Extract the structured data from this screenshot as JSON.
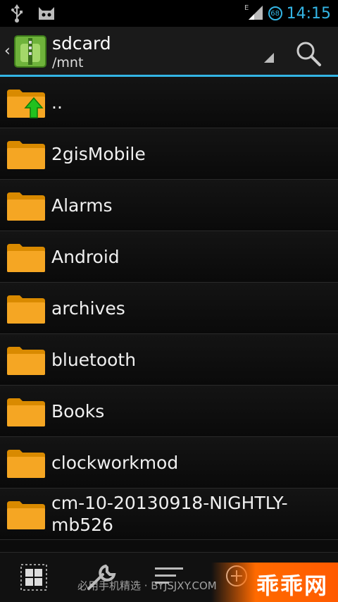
{
  "status_bar": {
    "clock": "14:15",
    "battery_level": "68",
    "network": "E",
    "colors": {
      "accent": "#33b5e5"
    },
    "icons": [
      "usb-icon",
      "cyanogen-icon",
      "signal-icon",
      "battery-icon"
    ]
  },
  "action_bar": {
    "title": "sdcard",
    "subtitle": "/mnt",
    "icons": [
      "back-chevron-icon",
      "app-icon",
      "dropdown-icon",
      "search-icon"
    ]
  },
  "files": [
    {
      "name": "..",
      "type": "parent"
    },
    {
      "name": "2gisMobile",
      "type": "folder"
    },
    {
      "name": "Alarms",
      "type": "folder"
    },
    {
      "name": "Android",
      "type": "folder"
    },
    {
      "name": "archives",
      "type": "folder"
    },
    {
      "name": "bluetooth",
      "type": "folder"
    },
    {
      "name": "Books",
      "type": "folder"
    },
    {
      "name": "clockworkmod",
      "type": "folder"
    },
    {
      "name": "cm-10-20130918-NIGHTLY-mb526",
      "type": "folder"
    }
  ],
  "bottom_bar": {
    "icons": [
      "select-all-icon",
      "tools-icon",
      "sort-icon",
      "add-icon"
    ]
  },
  "watermark": {
    "text": "必用手机精选 · BYJSJXY.COM",
    "brand": "乖乖网"
  },
  "colors": {
    "folder": "#f5a623",
    "folder_dark": "#d98a00",
    "background": "#0c0c0c"
  }
}
